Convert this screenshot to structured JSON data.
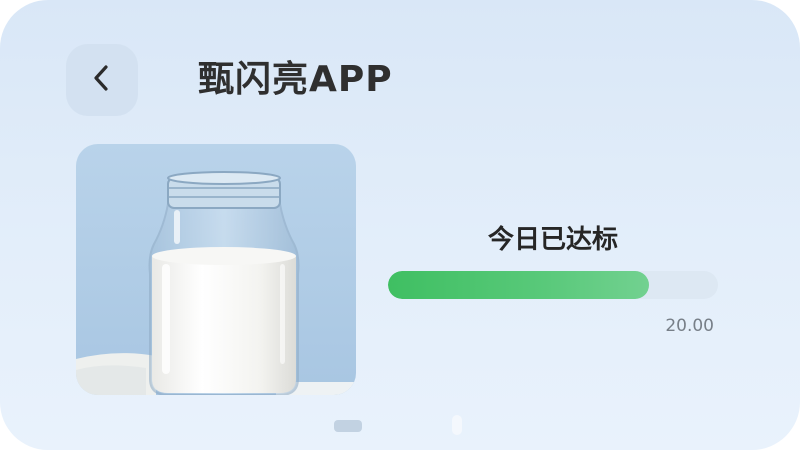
{
  "header": {
    "title": "甄闪亮APP",
    "back_icon": "chevron-left-icon"
  },
  "media": {
    "image_subject": "milk bottle photo"
  },
  "status": {
    "label": "今日已达标",
    "value_text": "20.00",
    "progress_percent": 79,
    "fill_color": "#44c266"
  }
}
